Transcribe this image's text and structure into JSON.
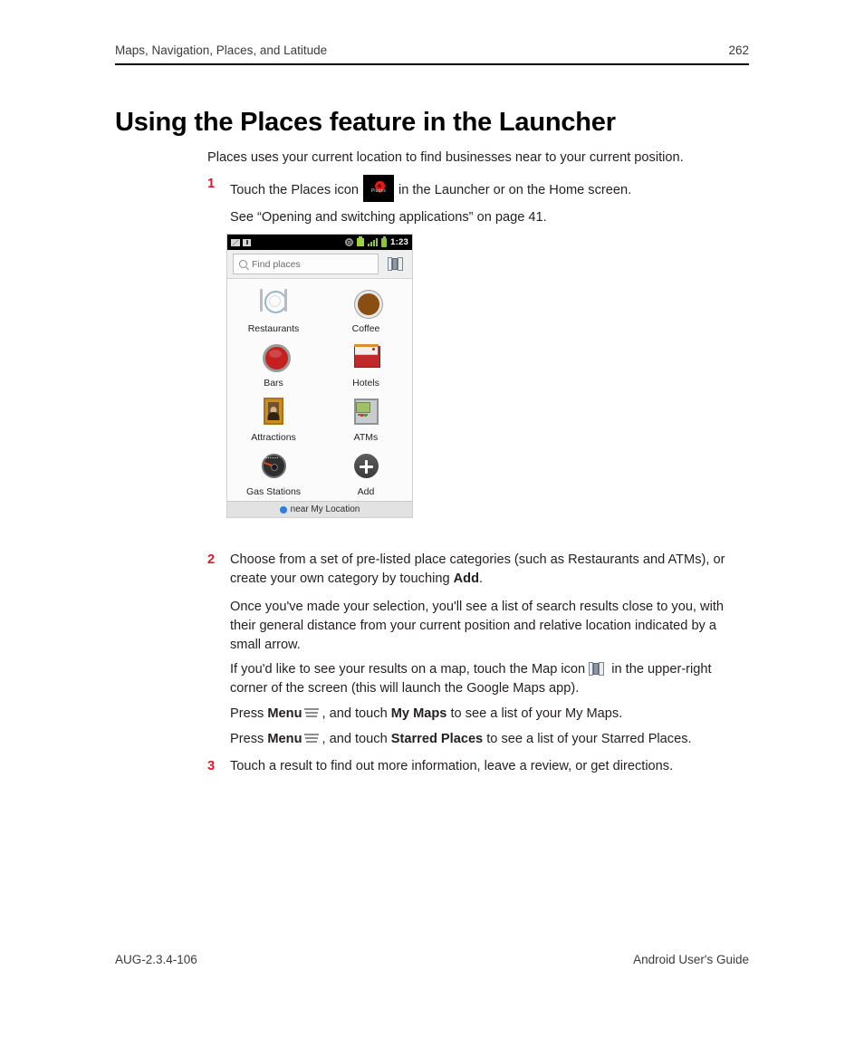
{
  "header": {
    "chapter": "Maps, Navigation, Places, and Latitude",
    "page_number": "262"
  },
  "title": "Using the Places feature in the Launcher",
  "intro": "Places uses your current location to find businesses near to your current position.",
  "steps": {
    "one_num": "1",
    "one_text_a": "Touch the Places icon",
    "one_text_b": "in the Launcher or on the Home screen.",
    "one_text_c": "See “Opening and switching applications” on page 41.",
    "two_num": "2",
    "two_text_a": "Choose from a set of pre-listed place categories (such as Restaurants and ATMs), or create your own category by touching ",
    "two_bold": "Add",
    "two_text_b": ".",
    "three_num": "3",
    "three_text": "Touch a result to find out more information, leave a review, or get directions."
  },
  "paragraphs": {
    "results": "Once you've made your selection, you'll see a list of search results close to you, with their general distance from your current position and relative location indicated by a small arrow.",
    "map_a": "If you'd like to see your results on a map, touch the Map icon",
    "map_b": "in the upper-right corner of the screen (this will launch the Google Maps app).",
    "press": "Press",
    "menu_bold": "Menu",
    "mymaps_a": ", and touch",
    "mymaps_bold": "My Maps",
    "mymaps_b": "to see a list of your My Maps.",
    "starred_a": ", and touch",
    "starred_bold": "Starred Places",
    "starred_b": "to see a list of your Starred Places."
  },
  "places_icon_label": "Places",
  "phone": {
    "status_time": "1:23",
    "search_placeholder": "Find places",
    "categories": [
      {
        "label": "Restaurants"
      },
      {
        "label": "Coffee"
      },
      {
        "label": "Bars"
      },
      {
        "label": "Hotels"
      },
      {
        "label": "Attractions"
      },
      {
        "label": "ATMs"
      },
      {
        "label": "Gas Stations"
      },
      {
        "label": "Add"
      }
    ],
    "location_bar": "near My Location"
  },
  "footer": {
    "doc_code": "AUG-2.3.4-106",
    "guide_name": "Android User's Guide"
  },
  "colors": {
    "step_number": "#e1142d",
    "accent_blue": "#2d7fe0",
    "status_green": "#8cc63e"
  }
}
